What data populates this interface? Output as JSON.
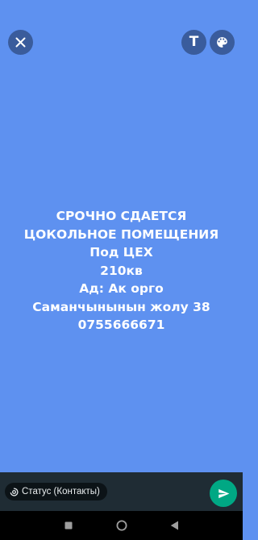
{
  "toolbar": {
    "close_icon": "close-icon",
    "text_tool_label": "T",
    "palette_icon": "palette-icon"
  },
  "status_post": {
    "background_color": "#5e91f0",
    "lines": [
      "СРОЧНО СДАЕТСЯ",
      "ЦОКОЛЬНОЕ ПОМЕЩЕНИЯ",
      "Под ЦЕХ",
      "210кв",
      "Ад: Ак орго",
      "Саманчынынын жолу 38",
      "0755666671"
    ]
  },
  "bottom_bar": {
    "audience_label": "Статус (Контакты)",
    "audience_icon": "status-ring-icon",
    "send_icon": "send-icon",
    "send_color": "#00a884"
  },
  "nav": {
    "recent_icon": "recent-apps-icon",
    "home_icon": "home-icon",
    "back_icon": "back-icon"
  }
}
